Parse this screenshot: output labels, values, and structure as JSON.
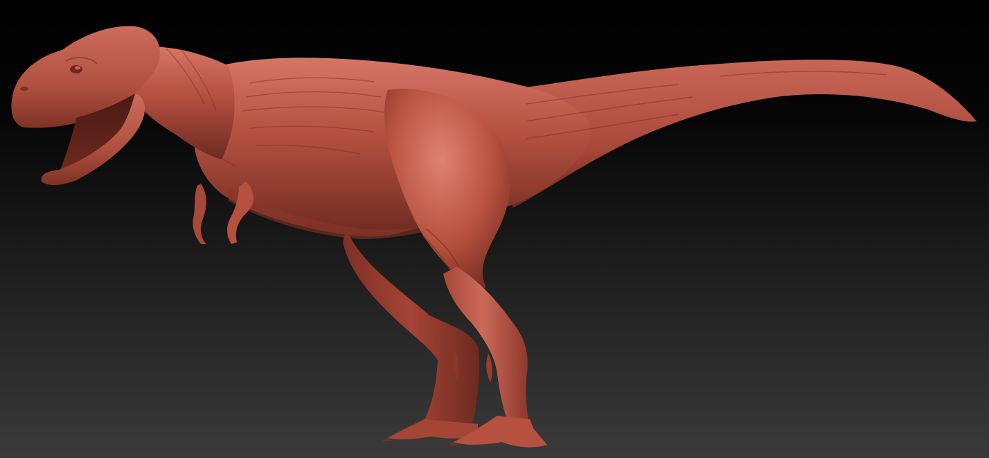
{
  "scene": {
    "subject": "t-rex-sculpt",
    "view": "side-profile-facing-left",
    "background_colors": {
      "top": "#000000",
      "bottom": "#3a3a3a"
    },
    "material_colors": {
      "base": "#b24f3f",
      "highlight": "#d67666",
      "shadow": "#5f2219",
      "deep_shadow": "#3a140f"
    }
  }
}
